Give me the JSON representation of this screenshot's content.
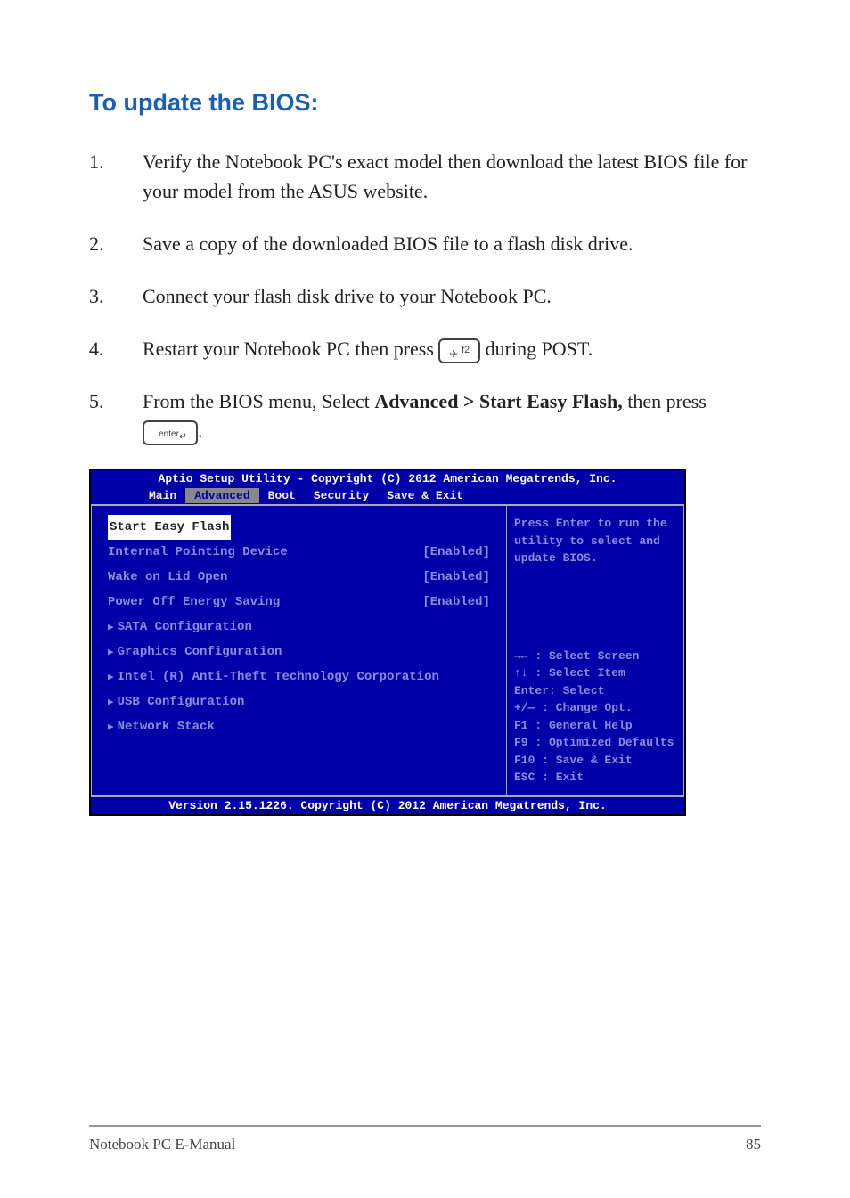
{
  "heading": "To update the BIOS:",
  "steps": [
    {
      "num": "1.",
      "text": "Verify the Notebook PC's exact model then download the latest BIOS file for your model from the ASUS website."
    },
    {
      "num": "2.",
      "text": "Save a copy of the downloaded BIOS file to a flash disk drive."
    },
    {
      "num": "3.",
      "text": "Connect your flash disk drive to your Notebook PC."
    },
    {
      "num": "4.",
      "prefix": "Restart your Notebook PC then press ",
      "key": "f2",
      "suffix": " during POST."
    },
    {
      "num": "5.",
      "prefix": "From the BIOS menu, Select ",
      "bold": "Advanced > Start Easy Flash,",
      "mid": " then press ",
      "key": "enter",
      "suffix": "."
    }
  ],
  "bios": {
    "titlebar": "Aptio Setup Utility - Copyright (C) 2012 American Megatrends, Inc.",
    "menubar": [
      "Main",
      "Advanced",
      "Boot",
      "Security",
      "Save & Exit"
    ],
    "active_tab": "Advanced",
    "left_items": [
      {
        "label": "Start Easy Flash",
        "value": "",
        "highlight": true
      },
      {
        "label": "Internal Pointing Device",
        "value": "[Enabled]"
      },
      {
        "label": "Wake on Lid Open",
        "value": "[Enabled]"
      },
      {
        "label": "Power Off Energy Saving",
        "value": "[Enabled]"
      },
      {
        "label": "SATA Configuration",
        "tri": true
      },
      {
        "label": "Graphics Configuration",
        "tri": true
      },
      {
        "label": "Intel (R) Anti-Theft Technology Corporation",
        "tri": true
      },
      {
        "label": "USB Configuration",
        "tri": true
      },
      {
        "label": "Network Stack",
        "tri": true
      }
    ],
    "help_text": "Press Enter to run the utility to select and update BIOS.",
    "key_help": [
      "→←   : Select Screen",
      "↑↓   : Select Item",
      "Enter: Select",
      "+/—  : Change Opt.",
      "F1   : General Help",
      "F9   : Optimized Defaults",
      "F10  : Save & Exit",
      "ESC  : Exit"
    ],
    "footer": "Version 2.15.1226. Copyright (C) 2012 American Megatrends, Inc."
  },
  "page_footer_left": "Notebook PC E-Manual",
  "page_footer_right": "85"
}
